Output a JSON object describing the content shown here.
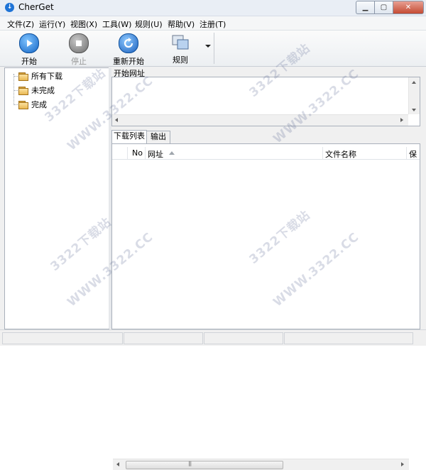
{
  "window": {
    "title": "CherGet",
    "icon": "app-icon"
  },
  "menu": [
    "文件(Z)",
    "运行(Y)",
    "视图(X)",
    "工具(W)",
    "规则(U)",
    "帮助(V)",
    "注册(T)"
  ],
  "toolbar": {
    "start": "开始",
    "stop": "停止",
    "restart": "重新开始",
    "rules": "规则"
  },
  "tree": [
    "所有下载",
    "未完成",
    "完成"
  ],
  "url_panel": {
    "label": "开始网址"
  },
  "tabs": [
    "下载列表",
    "输出"
  ],
  "list_columns": {
    "no": "No",
    "url": "网址",
    "filename": "文件名称",
    "save": "保"
  },
  "scroll_grip": "|||",
  "watermarks": [
    "3322下载站",
    "WWW.3322.CC"
  ],
  "colors": {
    "accent": "#1e73d6"
  }
}
